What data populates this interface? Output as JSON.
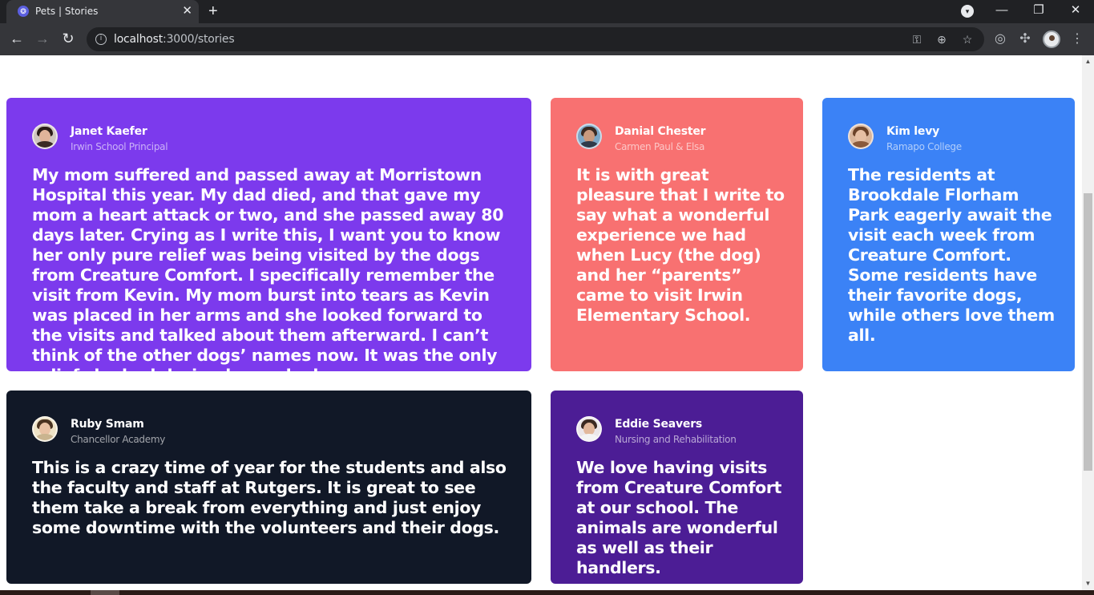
{
  "browser": {
    "tab_title": "Pets | Stories",
    "tab_close": "✕",
    "new_tab": "+",
    "url_host": "localhost",
    "url_path": ":3000/stories",
    "window_minimize": "—",
    "window_restore": "❐",
    "window_close": "✕"
  },
  "stories": [
    {
      "name": "Janet Kaefer",
      "role": "Irwin School Principal",
      "quote": "My mom suffered and passed away at Morristown Hospital this year. My dad died, and that gave my mom a heart attack or two, and she passed away 80 days later. Crying as I write this, I want you to know her only pure relief was being visited by the dogs from Creature Comfort. I specifically remember the visit from Kevin. My mom burst into tears as Kevin was placed in her arms and she looked forward to the visits and talked about them afterward. I can’t think of the other dogs’ names now. It was the only relief she had during her ordeal.",
      "color": "#7c3aed"
    },
    {
      "name": "Danial Chester",
      "role": "Carmen Paul & Elsa",
      "quote": "It is with great pleasure that I write to say what a wonderful experience we had when Lucy (the dog) and her “parents” came to visit Irwin Elementary School.",
      "color": "#f87171"
    },
    {
      "name": "Kim levy",
      "role": "Ramapo College",
      "quote": "The residents at Brookdale Florham Park eagerly await the visit each week from Creature Comfort. Some residents have their favorite dogs, while others love them all.",
      "color": "#3b82f6"
    },
    {
      "name": "Ruby Smam",
      "role": "Chancellor Academy",
      "quote": "This is a crazy time of year for the students and also the faculty and staff at Rutgers. It is great to see them take a break from everything and just enjoy some downtime with the volunteers and their dogs.",
      "color": "#111827"
    },
    {
      "name": "Eddie Seavers",
      "role": "Nursing and Rehabilitation",
      "quote": "We love having visits from Creature Comfort at our school. The animals are wonderful as well as their handlers.",
      "color": "#4c1d95"
    }
  ]
}
